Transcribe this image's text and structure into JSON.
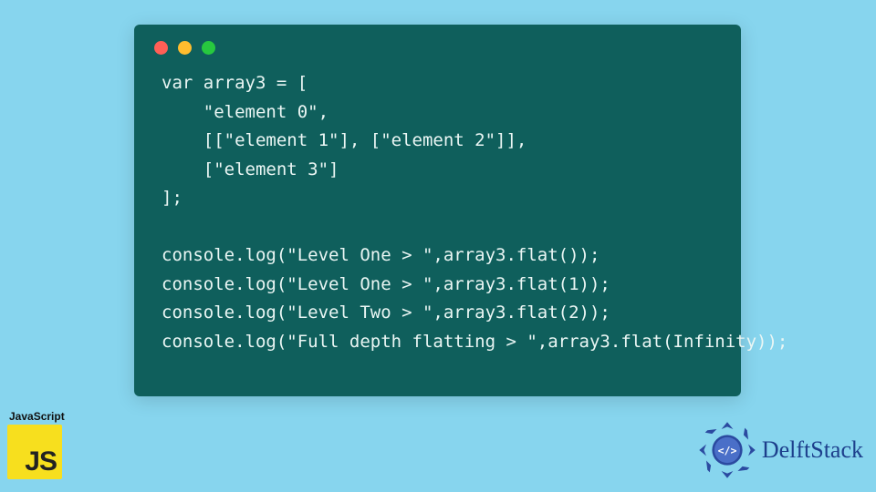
{
  "code": {
    "lines": [
      "var array3 = [",
      "    \"element 0\",",
      "    [[\"element 1\"], [\"element 2\"]],",
      "    [\"element 3\"]",
      "];",
      "",
      "console.log(\"Level One > \",array3.flat());",
      "console.log(\"Level One > \",array3.flat(1));",
      "console.log(\"Level Two > \",array3.flat(2));",
      "console.log(\"Full depth flatting > \",array3.flat(Infinity));"
    ]
  },
  "badges": {
    "js_label": "JavaScript",
    "js_glyph": "JS",
    "brand": "DelftStack"
  },
  "colors": {
    "page_bg": "#87d5ee",
    "window_bg": "#0f5f5c",
    "code_fg": "#eaf6f4",
    "js_tile": "#f7df1e",
    "brand_text": "#1d3f8c",
    "dot_red": "#ff5f56",
    "dot_yellow": "#ffbd2e",
    "dot_green": "#27c93f"
  }
}
